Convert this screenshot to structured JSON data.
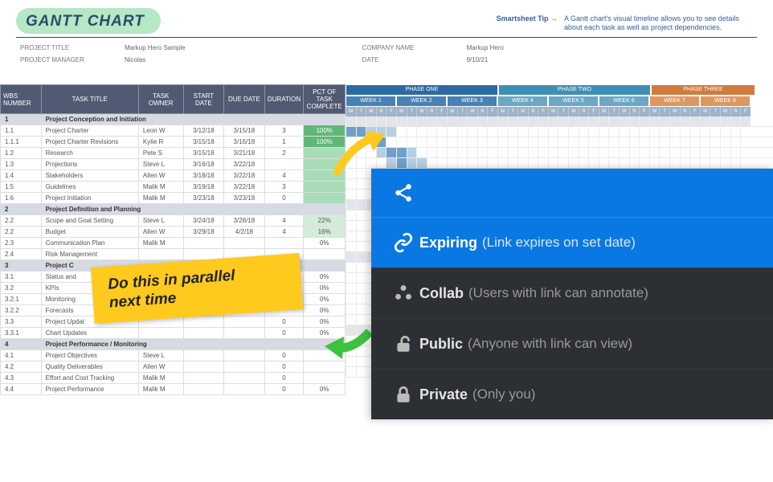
{
  "header": {
    "title": "GANTT CHART",
    "tip_label": "Smartsheet Tip →",
    "tip_text": "A Gantt chart's visual timeline allows you to see details about each task as well as project dependencies."
  },
  "meta": {
    "project_title_label": "PROJECT TITLE",
    "project_title_value": "Markup Hero Sample",
    "project_manager_label": "PROJECT MANAGER",
    "project_manager_value": "Nicolas",
    "company_label": "COMPANY NAME",
    "company_value": "Markup Hero",
    "date_label": "DATE",
    "date_value": "9/10/21"
  },
  "columns": {
    "wbs": "WBS NUMBER",
    "task": "TASK TITLE",
    "owner": "TASK OWNER",
    "start": "START DATE",
    "due": "DUE DATE",
    "duration": "DURATION",
    "pct": "PCT OF TASK COMPLETE"
  },
  "rows": [
    {
      "wbs": "1",
      "task": "Project Conception and Initiation",
      "section": true
    },
    {
      "wbs": "1.1",
      "task": "Project Charter",
      "owner": "Leon W",
      "start": "3/12/18",
      "due": "3/15/18",
      "dur": "3",
      "pct": "100%",
      "cls": "green"
    },
    {
      "wbs": "1.1.1",
      "task": "Project Charter Revisions",
      "owner": "Kylie R",
      "start": "3/15/18",
      "due": "3/16/18",
      "dur": "1",
      "pct": "100%",
      "cls": "green"
    },
    {
      "wbs": "1.2",
      "task": "Research",
      "owner": "Pete S",
      "start": "3/15/18",
      "due": "3/21/18",
      "dur": "2",
      "pct": "",
      "cls": "lightgreen"
    },
    {
      "wbs": "1.3",
      "task": "Projections",
      "owner": "Steve L",
      "start": "3/16/18",
      "due": "3/22/18",
      "dur": "",
      "pct": "",
      "cls": "lightgreen"
    },
    {
      "wbs": "1.4",
      "task": "Stakeholders",
      "owner": "Allen W",
      "start": "3/18/18",
      "due": "3/22/18",
      "dur": "4",
      "pct": "",
      "cls": "lightgreen"
    },
    {
      "wbs": "1.5",
      "task": "Guidelines",
      "owner": "Malik M",
      "start": "3/19/18",
      "due": "3/22/18",
      "dur": "3",
      "pct": "",
      "cls": "lightgreen"
    },
    {
      "wbs": "1.6",
      "task": "Project Initiation",
      "owner": "Malik M",
      "start": "3/23/18",
      "due": "3/23/18",
      "dur": "0",
      "pct": "",
      "cls": "lightgreen"
    },
    {
      "wbs": "2",
      "task": "Project Definition and Planning",
      "section": true
    },
    {
      "wbs": "2.2",
      "task": "Scope and Goal Setting",
      "owner": "Steve L",
      "start": "3/24/18",
      "due": "3/28/18",
      "dur": "4",
      "pct": "22%",
      "cls": "pale"
    },
    {
      "wbs": "2.2",
      "task": "Budget",
      "owner": "Allen W",
      "start": "3/29/18",
      "due": "4/2/18",
      "dur": "4",
      "pct": "16%",
      "cls": "pale"
    },
    {
      "wbs": "2.3",
      "task": "Communication Plan",
      "owner": "Malik M",
      "start": "",
      "due": "",
      "dur": "",
      "pct": "0%",
      "cls": ""
    },
    {
      "wbs": "2.4",
      "task": "Risk Management",
      "owner": "",
      "start": "",
      "due": "",
      "dur": "",
      "pct": "",
      "cls": ""
    },
    {
      "wbs": "3",
      "task": "Project C",
      "section": true
    },
    {
      "wbs": "3.1",
      "task": "Status and",
      "owner": "",
      "start": "",
      "due": "",
      "dur": "",
      "pct": "0%",
      "cls": ""
    },
    {
      "wbs": "3.2",
      "task": "KPIs",
      "owner": "",
      "start": "",
      "due": "",
      "dur": "",
      "pct": "0%",
      "cls": ""
    },
    {
      "wbs": "3.2.1",
      "task": "Monitoring",
      "owner": "",
      "start": "",
      "due": "",
      "dur": "",
      "pct": "0%",
      "cls": ""
    },
    {
      "wbs": "3.2.2",
      "task": "Forecasts",
      "owner": "",
      "start": "",
      "due": "",
      "dur": "",
      "pct": "0%",
      "cls": ""
    },
    {
      "wbs": "3.3",
      "task": "Project Updat",
      "owner": "",
      "start": "",
      "due": "",
      "dur": "0",
      "pct": "0%",
      "cls": ""
    },
    {
      "wbs": "3.3.1",
      "task": "Chart Updates",
      "owner": "",
      "start": "",
      "due": "",
      "dur": "0",
      "pct": "0%",
      "cls": ""
    },
    {
      "wbs": "4",
      "task": "Project Performance / Monitoring",
      "section": true
    },
    {
      "wbs": "4.1",
      "task": "Project Objectives",
      "owner": "Steve L",
      "start": "",
      "due": "",
      "dur": "0",
      "pct": "",
      "cls": ""
    },
    {
      "wbs": "4.2",
      "task": "Quality Deliverables",
      "owner": "Allen W",
      "start": "",
      "due": "",
      "dur": "0",
      "pct": "",
      "cls": ""
    },
    {
      "wbs": "4.3",
      "task": "Effort and Cost Tracking",
      "owner": "Malik M",
      "start": "",
      "due": "",
      "dur": "0",
      "pct": "",
      "cls": ""
    },
    {
      "wbs": "4.4",
      "task": "Project Performance",
      "owner": "Malik M",
      "start": "",
      "due": "",
      "dur": "0",
      "pct": "0%",
      "cls": ""
    }
  ],
  "gantt": {
    "phases": [
      "PHASE ONE",
      "PHASE TWO",
      "PHASE THREE"
    ],
    "weeks": [
      "WEEK 1",
      "WEEK 2",
      "WEEK 3",
      "WEEK 4",
      "WEEK 5",
      "WEEK 6",
      "WEEK 7",
      "WEEK 8"
    ],
    "days": [
      "M",
      "T",
      "W",
      "R",
      "F"
    ]
  },
  "annotation": {
    "note_line1": "Do this in parallel",
    "note_line2": "next time"
  },
  "share": {
    "expiring_label": "Expiring",
    "expiring_desc": "(Link expires on set date)",
    "collab_label": "Collab",
    "collab_desc": "(Users with link can annotate)",
    "public_label": "Public",
    "public_desc": "(Anyone with link can view)",
    "private_label": "Private",
    "private_desc": "(Only you)"
  }
}
